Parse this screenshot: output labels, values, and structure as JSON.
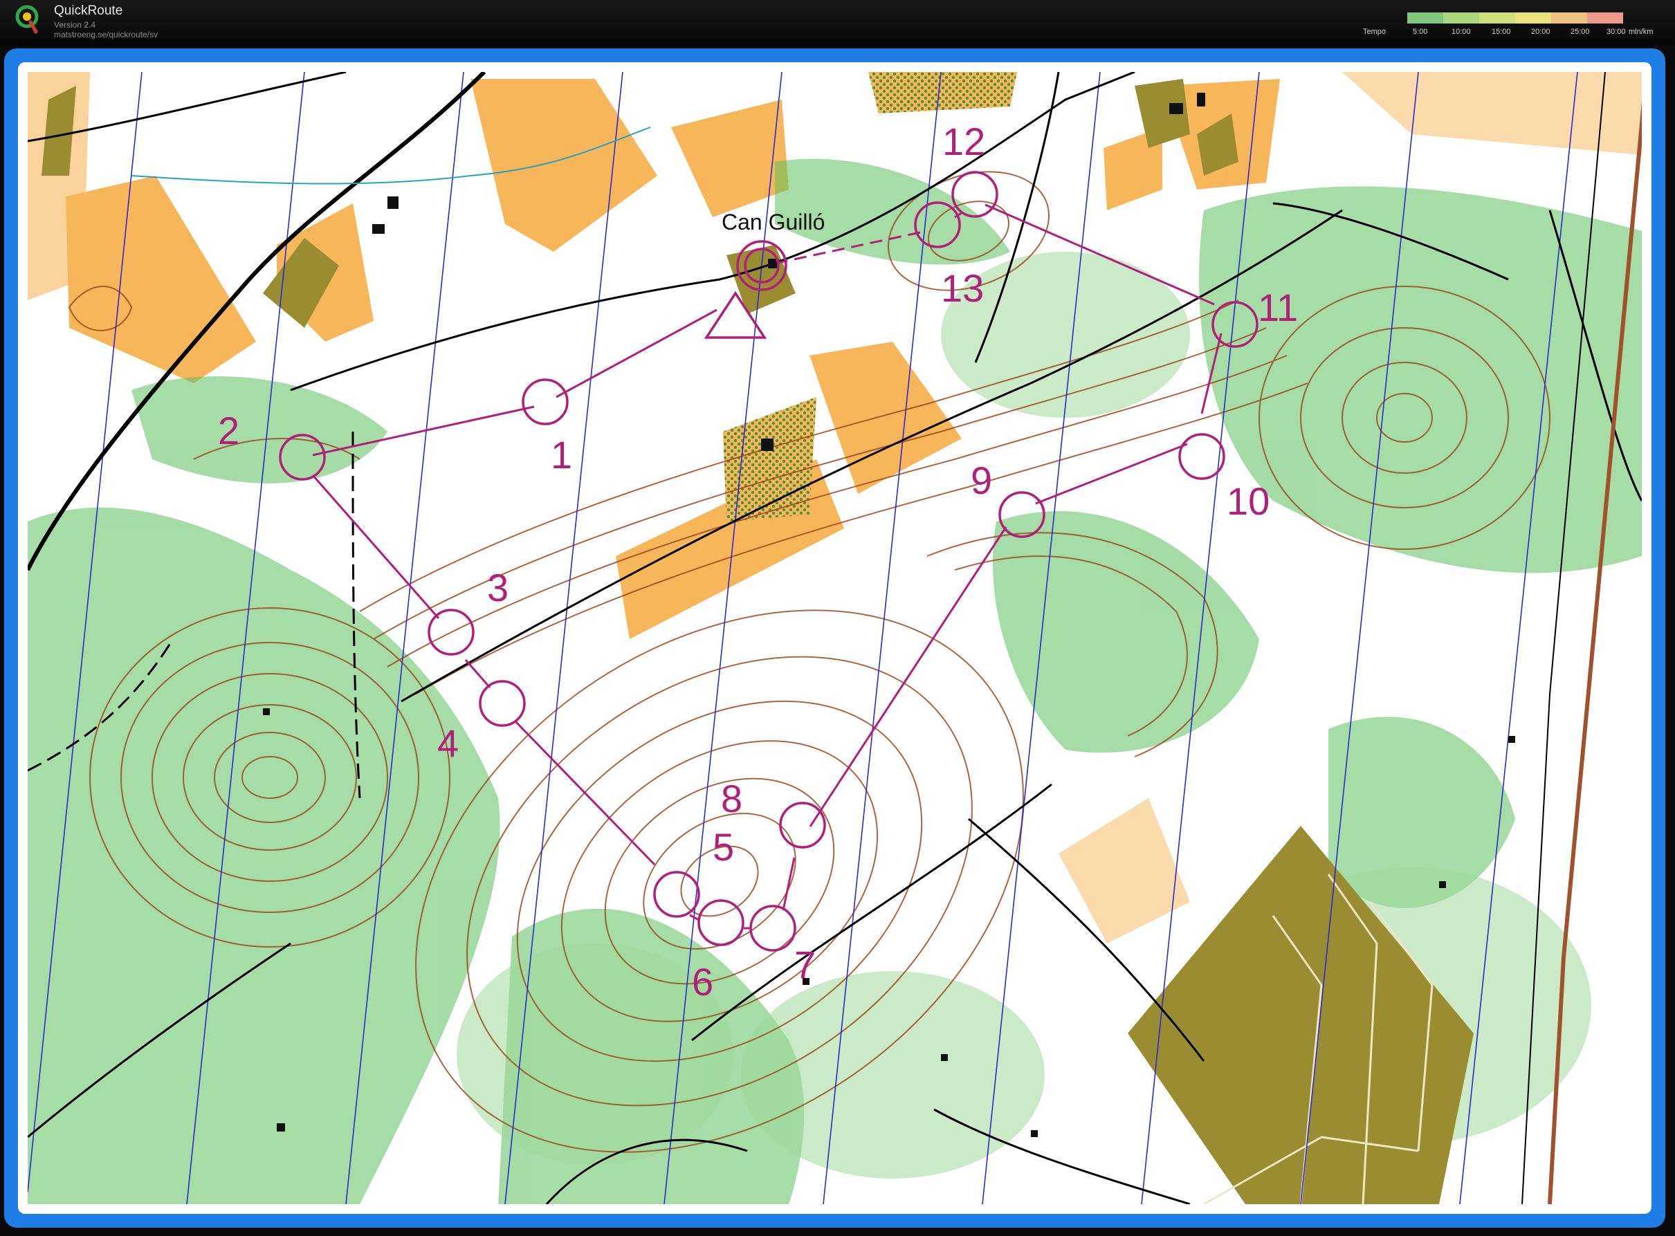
{
  "app": {
    "name": "QuickRoute",
    "version": "Version 2.4",
    "url": "matstroeng.se/quickroute/sv"
  },
  "pace_legend": {
    "title": "Tempo",
    "ticks": [
      "5:00",
      "10:00",
      "15:00",
      "20:00",
      "25:00",
      "30:00"
    ],
    "unit": "min/km",
    "colors": [
      "#7fc77a",
      "#a9d77a",
      "#cfe07a",
      "#e8e27c",
      "#f0c27f",
      "#ee9a8a"
    ]
  },
  "colors": {
    "frame": "#1f7de6",
    "course": "#b0207a",
    "open_land": "#f7b65a",
    "forest_green": "#5cbf5c",
    "contour": "#9c4a1e",
    "field_olive": "#9a8c30"
  },
  "map": {
    "place_name": "Can Guilló",
    "controls": [
      {
        "label": "1"
      },
      {
        "label": "2"
      },
      {
        "label": "3"
      },
      {
        "label": "4"
      },
      {
        "label": "5"
      },
      {
        "label": "6"
      },
      {
        "label": "7"
      },
      {
        "label": "8"
      },
      {
        "label": "9"
      },
      {
        "label": "10"
      },
      {
        "label": "11"
      },
      {
        "label": "12"
      },
      {
        "label": "13"
      }
    ]
  }
}
